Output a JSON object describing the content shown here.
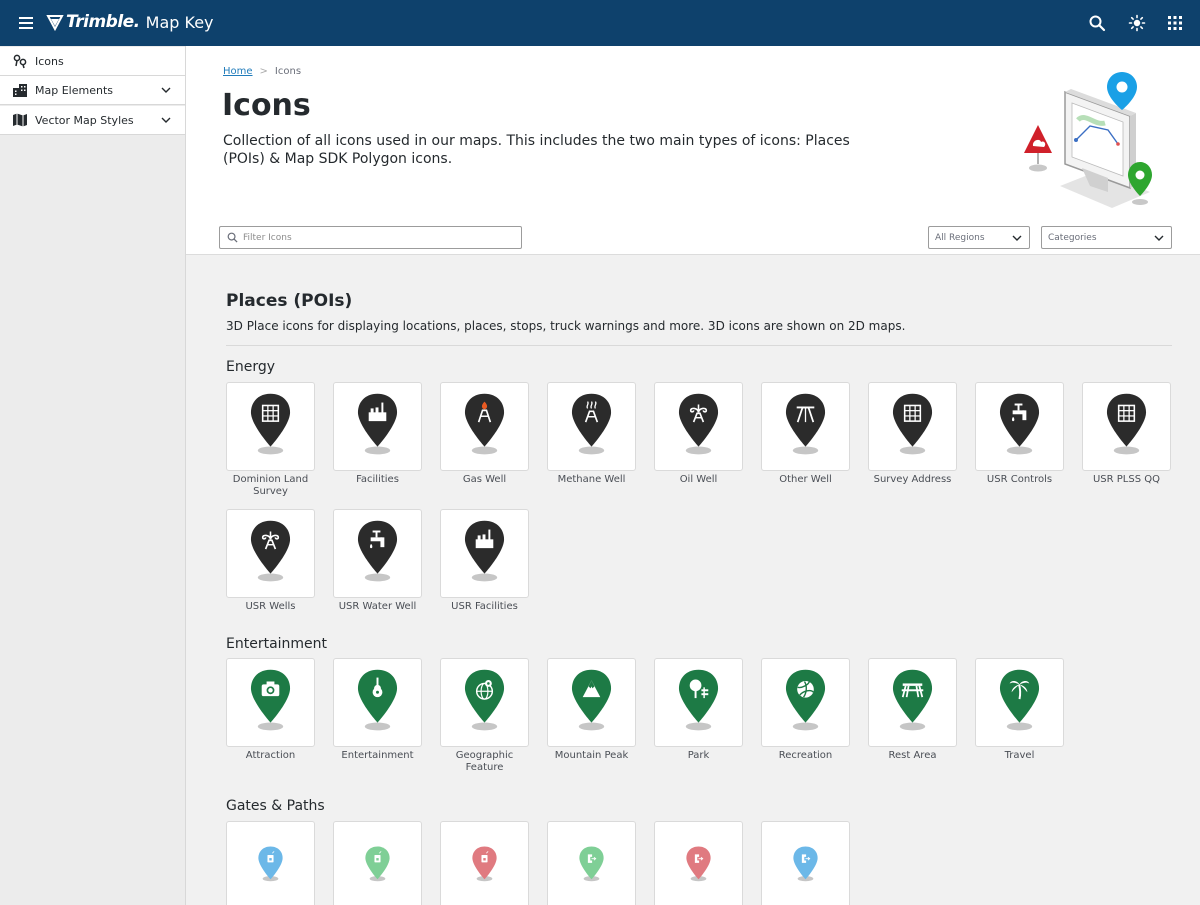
{
  "header": {
    "brand": "Trimble.",
    "app_name": "Map Key"
  },
  "sidebar": {
    "items": [
      {
        "label": "Icons",
        "icon": "map-pins-icon"
      },
      {
        "label": "Map Elements",
        "icon": "buildings-icon"
      },
      {
        "label": "Vector Map Styles",
        "icon": "map-icon"
      }
    ]
  },
  "breadcrumb": {
    "home": "Home",
    "current": "Icons"
  },
  "page": {
    "title": "Icons",
    "description": "Collection of all icons used in our maps. This includes the two main types of icons: Places (POIs) & Map SDK Polygon icons."
  },
  "filters": {
    "search_placeholder": "Filter Icons",
    "regions": "All Regions",
    "categories": "Categories"
  },
  "section": {
    "title": "Places (POIs)",
    "description": "3D Place icons for displaying locations, places, stops, truck warnings and more. 3D icons are shown on 2D maps."
  },
  "colors": {
    "header": "#0e416c",
    "energy": "#2b2b2b",
    "entertainment": "#1d7a45",
    "link": "#217cbb"
  },
  "groups": [
    {
      "title": "Energy",
      "items": [
        {
          "label": "Dominion Land Survey",
          "glyph": "grid"
        },
        {
          "label": "Facilities",
          "glyph": "factory"
        },
        {
          "label": "Gas Well",
          "glyph": "gaswell"
        },
        {
          "label": "Methane Well",
          "glyph": "methane"
        },
        {
          "label": "Oil Well",
          "glyph": "oilwell"
        },
        {
          "label": "Other Well",
          "glyph": "otherwell"
        },
        {
          "label": "Survey Address",
          "glyph": "grid"
        },
        {
          "label": "USR Controls",
          "glyph": "tap"
        },
        {
          "label": "USR PLSS QQ",
          "glyph": "grid"
        },
        {
          "label": "USR Wells",
          "glyph": "oilwell"
        },
        {
          "label": "USR Water Well",
          "glyph": "tap"
        },
        {
          "label": "USR Facilities",
          "glyph": "factory"
        }
      ]
    },
    {
      "title": "Entertainment",
      "items": [
        {
          "label": "Attraction",
          "glyph": "camera"
        },
        {
          "label": "Entertainment",
          "glyph": "guitar"
        },
        {
          "label": "Geographic Feature",
          "glyph": "globe"
        },
        {
          "label": "Mountain Peak",
          "glyph": "mountain"
        },
        {
          "label": "Park",
          "glyph": "park"
        },
        {
          "label": "Recreation",
          "glyph": "ball"
        },
        {
          "label": "Rest Area",
          "glyph": "picnic"
        },
        {
          "label": "Travel",
          "glyph": "palm"
        }
      ]
    },
    {
      "title": "Gates & Paths",
      "items": [
        {
          "glyph": "gate",
          "color": "#6cb8e8"
        },
        {
          "glyph": "gate",
          "color": "#7fcf96"
        },
        {
          "glyph": "gate",
          "color": "#e07a80"
        },
        {
          "glyph": "gatearrow",
          "color": "#7fcf96"
        },
        {
          "glyph": "gatearrow",
          "color": "#e07a80"
        },
        {
          "glyph": "gatearrow",
          "color": "#6cb8e8"
        }
      ]
    }
  ]
}
